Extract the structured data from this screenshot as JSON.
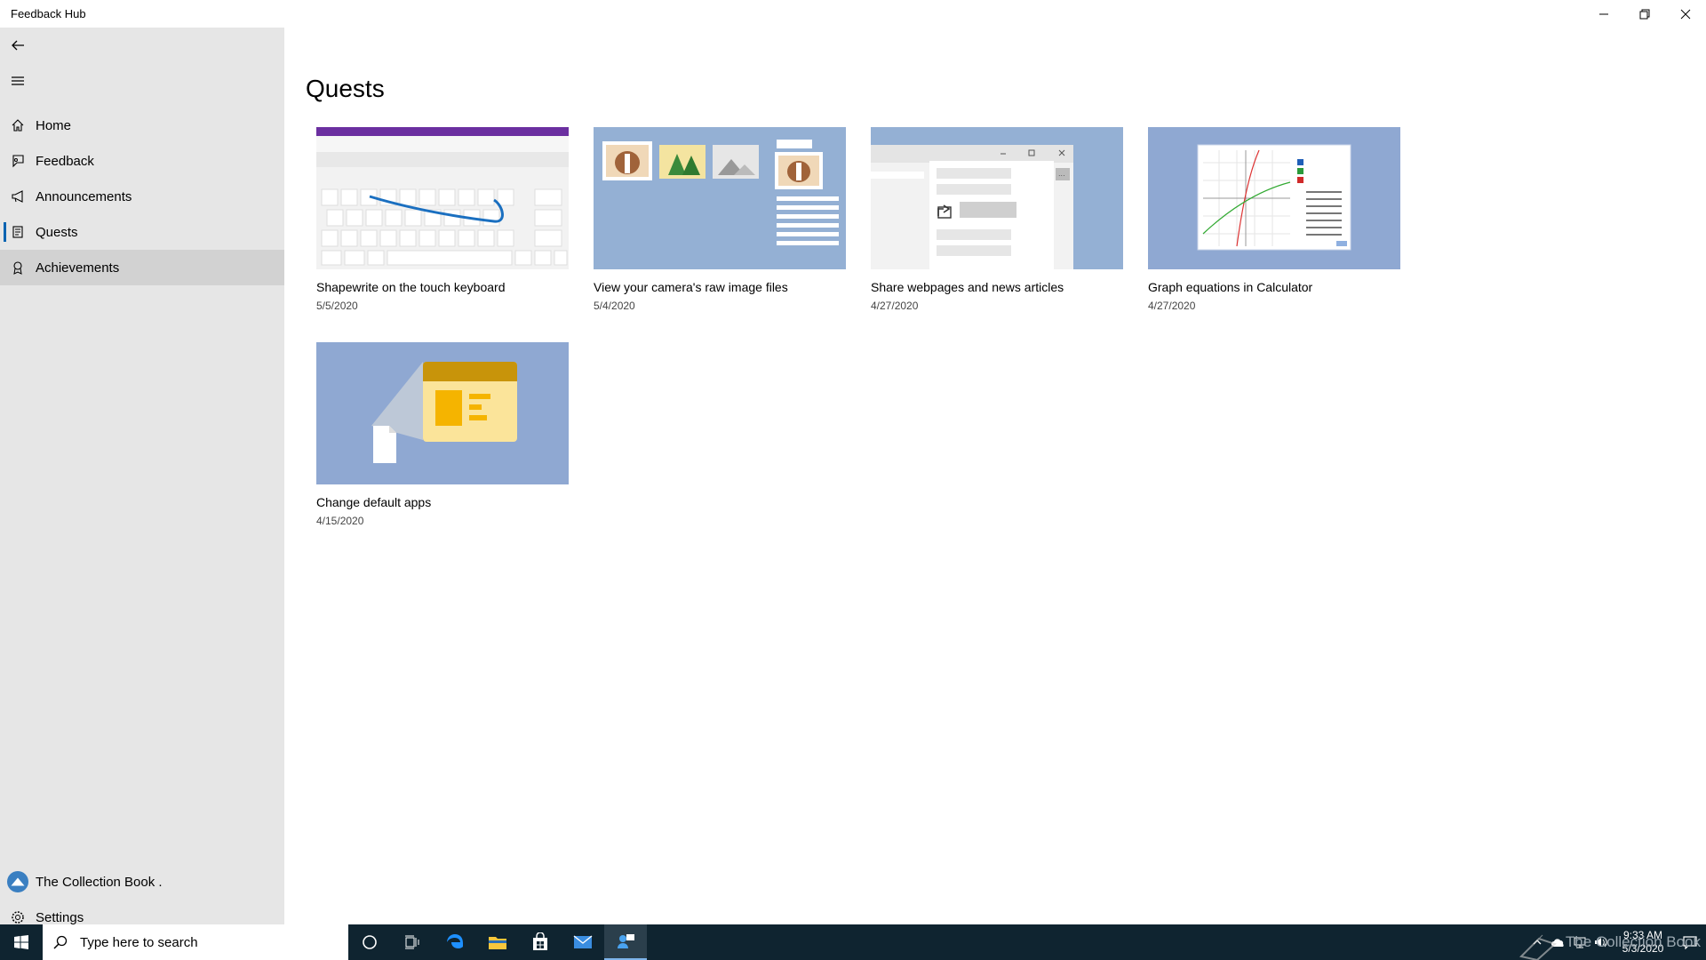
{
  "window": {
    "title": "Feedback Hub"
  },
  "sidebar": {
    "items": [
      {
        "label": "Home",
        "icon": "home-icon"
      },
      {
        "label": "Feedback",
        "icon": "feedback-icon"
      },
      {
        "label": "Announcements",
        "icon": "megaphone-icon"
      },
      {
        "label": "Quests",
        "icon": "quest-scroll-icon",
        "selected": true
      },
      {
        "label": "Achievements",
        "icon": "badge-icon",
        "hovered": true
      }
    ],
    "account_label": "The Collection Book .",
    "settings_label": "Settings"
  },
  "main": {
    "page_title": "Quests",
    "quests": [
      {
        "title": "Shapewrite on the touch keyboard",
        "date": "5/5/2020"
      },
      {
        "title": "View your camera's raw image files",
        "date": "5/4/2020"
      },
      {
        "title": "Share webpages and news articles",
        "date": "4/27/2020"
      },
      {
        "title": "Graph equations in Calculator",
        "date": "4/27/2020"
      },
      {
        "title": "Change default apps",
        "date": "4/15/2020"
      }
    ]
  },
  "taskbar": {
    "search_placeholder": "Type here to search",
    "time": "9:33 AM",
    "date": "5/3/2020",
    "watermark": "The Collection Book"
  },
  "colors": {
    "accent": "#0063b1",
    "sidebar_bg": "#e6e6e6",
    "taskbar_bg": "#0f2430",
    "thumb_blue": "#94b0d4"
  }
}
